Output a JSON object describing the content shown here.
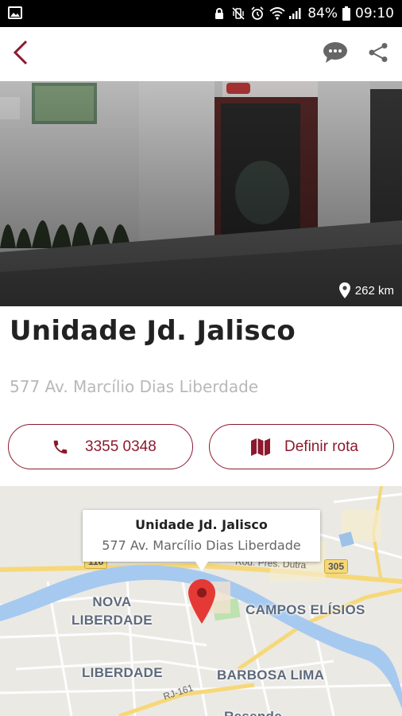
{
  "status_bar": {
    "battery": "84%",
    "time": "09:10",
    "icons": [
      "image-icon",
      "lock-icon",
      "vibrate-mute-icon",
      "alarm-icon",
      "wifi-icon",
      "signal-icon",
      "battery-icon"
    ]
  },
  "app_bar": {
    "back_icon": "chevron-left-icon",
    "chat_icon": "chat-bubble-icon",
    "share_icon": "share-icon",
    "accent_color": "#8b1a2e"
  },
  "hero": {
    "distance": "262 km",
    "distance_icon": "map-pin-icon"
  },
  "unit": {
    "name": "Unidade Jd. Jalisco",
    "address": "577 Av. Marcílio Dias Liberdade"
  },
  "actions": {
    "phone_label": "3355 0348",
    "phone_icon": "phone-icon",
    "route_label": "Definir rota",
    "route_icon": "map-icon"
  },
  "map": {
    "infowindow_title": "Unidade Jd. Jalisco",
    "infowindow_address": "577 Av. Marcílio Dias Liberdade",
    "labels": {
      "nova_liberdade": "NOVA\nLIBERDADE",
      "campos_elisios": "CAMPOS ELÍSIOS",
      "liberdade": "LIBERDADE",
      "barbosa_lima": "BARBOSA LIMA",
      "road_dutra": "Rod. Pres. Dutra",
      "road_rj161": "RJ-161",
      "shield_305": "305",
      "shield_116": "116",
      "bottom_partial": "Resende"
    },
    "marker_color": "#e53935"
  }
}
